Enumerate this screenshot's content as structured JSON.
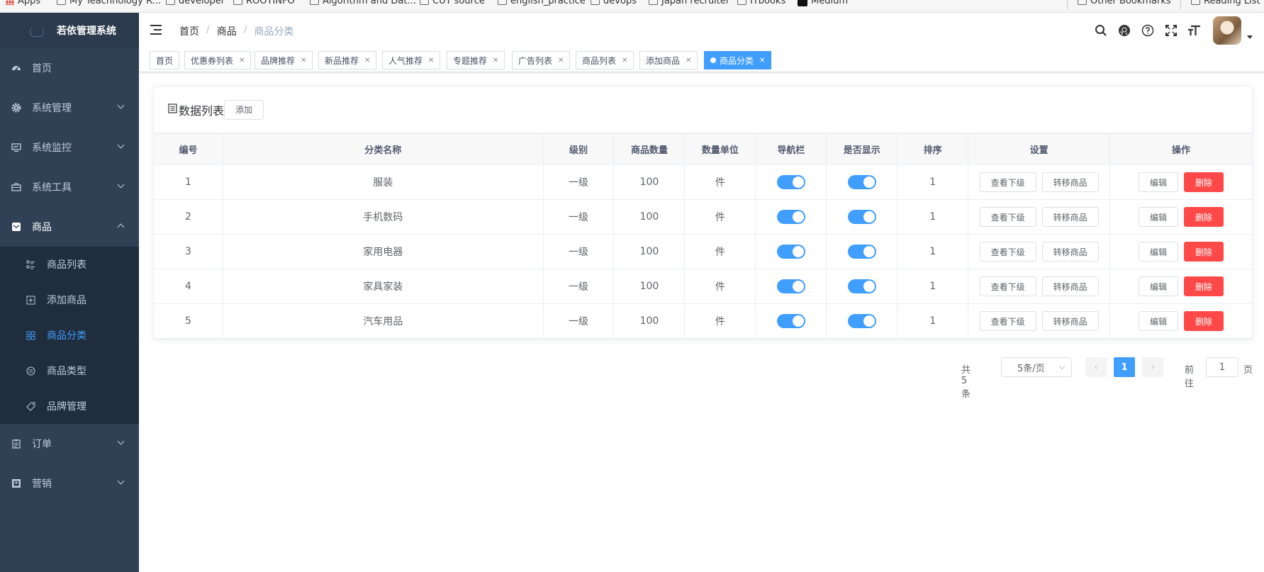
{
  "bookmarks": [
    {
      "label": "Apps",
      "icon": "apps-grid-icon"
    },
    {
      "label": "My Teachnology R...",
      "icon": "folder-icon"
    },
    {
      "label": "developer",
      "icon": "folder-icon"
    },
    {
      "label": "ROOTINFO",
      "icon": "folder-icon"
    },
    {
      "label": "Algorithm and Dat...",
      "icon": "folder-icon"
    },
    {
      "label": "CUT source",
      "icon": "folder-icon"
    },
    {
      "label": "english_practice",
      "icon": "folder-icon"
    },
    {
      "label": "devops",
      "icon": "folder-icon"
    },
    {
      "label": "Japan recruiter",
      "icon": "folder-icon"
    },
    {
      "label": "ITbooks",
      "icon": "folder-icon"
    },
    {
      "label": "Medium",
      "icon": "medium-logo-icon"
    },
    {
      "label": "Other Bookmarks",
      "icon": "folder-icon"
    },
    {
      "label": "Reading List",
      "icon": "reading-list-icon"
    }
  ],
  "app_title": "若依管理系统",
  "sidebar": {
    "items": [
      {
        "label": "首页",
        "icon": "dashboard-icon",
        "expandable": false
      },
      {
        "label": "系统管理",
        "icon": "gear-icon",
        "expandable": true
      },
      {
        "label": "系统监控",
        "icon": "monitor-icon",
        "expandable": true
      },
      {
        "label": "系统工具",
        "icon": "toolbox-icon",
        "expandable": true
      },
      {
        "label": "商品",
        "icon": "mail-icon",
        "expandable": true,
        "open": true
      }
    ],
    "sub_items": [
      {
        "label": "商品列表",
        "icon": "list-icon"
      },
      {
        "label": "添加商品",
        "icon": "plus-square-icon"
      },
      {
        "label": "商品分类",
        "icon": "category-grid-icon",
        "active": true
      },
      {
        "label": "商品类型",
        "icon": "type-circle-icon"
      },
      {
        "label": "品牌管理",
        "icon": "tag-icon"
      }
    ],
    "bottom_items": [
      {
        "label": "订单",
        "icon": "clipboard-icon",
        "expandable": true
      },
      {
        "label": "营销",
        "icon": "picture-icon",
        "expandable": true
      }
    ]
  },
  "breadcrumb": [
    "首页",
    "商品",
    "商品分类"
  ],
  "header_tools": [
    "search-icon",
    "github-icon",
    "question-icon",
    "fullscreen-icon",
    "font-size-icon"
  ],
  "tags": [
    {
      "label": "首页",
      "closable": false
    },
    {
      "label": "优惠券列表",
      "closable": true
    },
    {
      "label": "品牌推荐",
      "closable": true
    },
    {
      "label": "新品推荐",
      "closable": true
    },
    {
      "label": "人气推荐",
      "closable": true
    },
    {
      "label": "专题推荐",
      "closable": true
    },
    {
      "label": "广告列表",
      "closable": true
    },
    {
      "label": "商品列表",
      "closable": true
    },
    {
      "label": "添加商品",
      "closable": true
    },
    {
      "label": "商品分类",
      "closable": true,
      "active": true
    }
  ],
  "card": {
    "title": "数据列表",
    "add_label": "添加"
  },
  "table": {
    "columns": [
      "编号",
      "分类名称",
      "级别",
      "商品数量",
      "数量单位",
      "导航栏",
      "是否显示",
      "排序",
      "设置",
      "操作"
    ],
    "rows": [
      {
        "id": "1",
        "name": "服装",
        "level": "一级",
        "count": "100",
        "unit": "件",
        "nav": true,
        "show": true,
        "sort": "1"
      },
      {
        "id": "2",
        "name": "手机数码",
        "level": "一级",
        "count": "100",
        "unit": "件",
        "nav": true,
        "show": true,
        "sort": "1"
      },
      {
        "id": "3",
        "name": "家用电器",
        "level": "一级",
        "count": "100",
        "unit": "件",
        "nav": true,
        "show": true,
        "sort": "1"
      },
      {
        "id": "4",
        "name": "家具家装",
        "level": "一级",
        "count": "100",
        "unit": "件",
        "nav": true,
        "show": true,
        "sort": "1"
      },
      {
        "id": "5",
        "name": "汽车用品",
        "level": "一级",
        "count": "100",
        "unit": "件",
        "nav": true,
        "show": true,
        "sort": "1"
      }
    ],
    "settings_buttons": [
      "查看下级",
      "转移商品"
    ],
    "action_buttons": [
      "编辑",
      "删除"
    ]
  },
  "pagination": {
    "total_text": "共 5 条",
    "page_size": "5条/页",
    "current_page": "1",
    "goto_label": "前往",
    "goto_value": "1",
    "page_unit": "页",
    "prev_icon": "chevron-left-icon",
    "next_icon": "chevron-right-icon"
  },
  "colors": {
    "sidebar_bg": "#304156",
    "submenu_bg": "#1f2d3d",
    "primary": "#409eff",
    "danger": "#ff4949"
  }
}
